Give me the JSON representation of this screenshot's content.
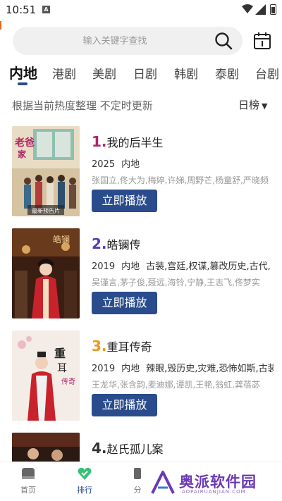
{
  "status_bar": {
    "time": "10:51",
    "notification_badge": "A"
  },
  "search": {
    "placeholder": "输入关键字查找",
    "icon": "search-icon"
  },
  "tabs": [
    {
      "label": "内地",
      "active": true
    },
    {
      "label": "港剧",
      "active": false
    },
    {
      "label": "美剧",
      "active": false
    },
    {
      "label": "日剧",
      "active": false
    },
    {
      "label": "韩剧",
      "active": false
    },
    {
      "label": "泰剧",
      "active": false
    },
    {
      "label": "台剧",
      "active": false
    }
  ],
  "subtitle": "根据当前热度整理 不定时更新",
  "rank_select": {
    "value": "日榜",
    "caret": "▼"
  },
  "items": [
    {
      "rank": "1.",
      "title": "我的后半生",
      "year": "2025",
      "region": "内地",
      "genres": "",
      "cast": "张国立,佟大为,梅婷,许娣,周野芒,杨童舒,严晓频",
      "play_label": "立即播放",
      "rank_color": "#b2246a",
      "poster_overlay": "最新预告片"
    },
    {
      "rank": "2.",
      "title": "皓镧传",
      "year": "2019",
      "region": "内地",
      "genres": "古装,宫廷,权谋,篡改历史,古代,",
      "cast": "吴谨言,茅子俊,聂远,海铃,宁静,王志飞,佟梦实",
      "play_label": "立即播放",
      "rank_color": "#5b3ab0"
    },
    {
      "rank": "3.",
      "title": "重耳传奇",
      "year": "2019",
      "region": "内地",
      "genres": "辣眼,毁历史,灾难,恐怖如斯,古装",
      "cast": "王龙华,张含韵,麦迪娜,谭凯,王艳,翁虹,龚蓓苾",
      "play_label": "立即播放",
      "rank_color": "#e89a1c"
    },
    {
      "rank": "4.",
      "title": "赵氏孤儿案",
      "year": "",
      "region": "",
      "genres": "",
      "cast": "",
      "play_label": "",
      "rank_color": "#333333"
    }
  ],
  "bottom_nav": [
    {
      "label": "首页",
      "icon": "home-icon",
      "active": false
    },
    {
      "label": "排行",
      "icon": "heart-ranking-icon",
      "active": true
    },
    {
      "label": "分",
      "icon": "category-icon",
      "active": false
    }
  ],
  "watermark": {
    "text": "奥派软件园",
    "sub": "AOPAIRUANJIAN.COM"
  },
  "colors": {
    "accent": "#2a4c8c",
    "background": "#ffffff"
  }
}
